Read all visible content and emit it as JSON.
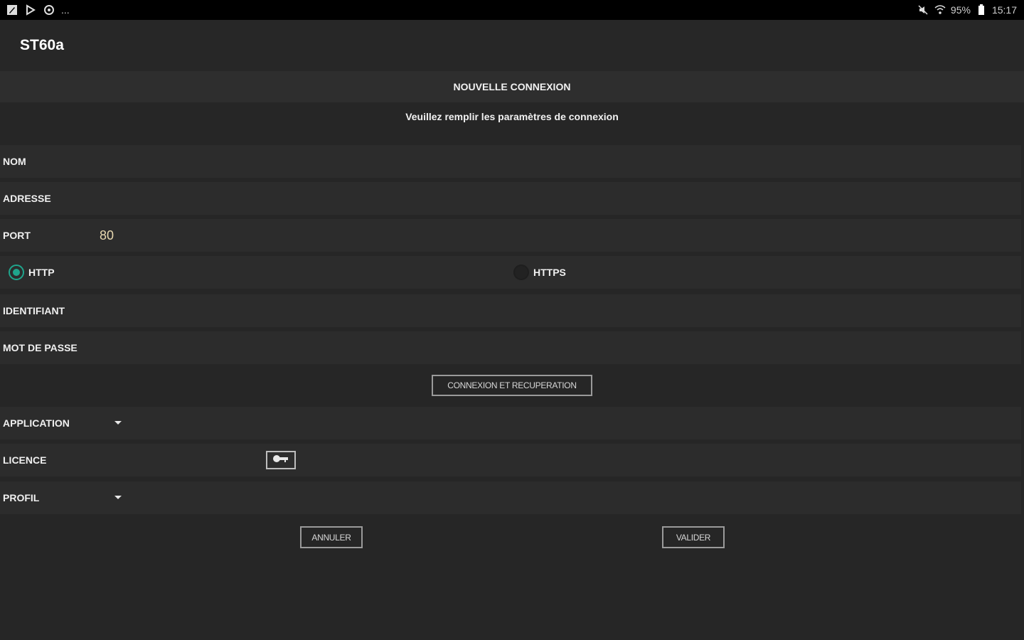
{
  "statusbar": {
    "left_icons": [
      "app-icon",
      "play-store-icon",
      "at-icon"
    ],
    "overflow": "...",
    "battery": "95%",
    "time": "15:17"
  },
  "app": {
    "title": "ST60a"
  },
  "header": {
    "title": "NOUVELLE CONNEXION",
    "subtitle": "Veuillez remplir les paramètres de connexion"
  },
  "form": {
    "nom": {
      "label": "NOM",
      "value": ""
    },
    "adresse": {
      "label": "ADRESSE",
      "value": ""
    },
    "port": {
      "label": "PORT",
      "value": "80"
    },
    "protocol": {
      "http_label": "HTTP",
      "https_label": "HTTPS",
      "selected": "HTTP"
    },
    "identifiant": {
      "label": "IDENTIFIANT",
      "value": ""
    },
    "mot_de_passe": {
      "label": "MOT DE PASSE",
      "value": ""
    },
    "connect_button": "CONNEXION ET RECUPERATION",
    "application": {
      "label": "APPLICATION"
    },
    "licence": {
      "label": "LICENCE"
    },
    "profil": {
      "label": "PROFIL"
    }
  },
  "actions": {
    "cancel": "ANNULER",
    "validate": "VALIDER"
  },
  "colors": {
    "accent": "#1fa58c",
    "background": "#262626",
    "row": "#2c2c2c"
  }
}
